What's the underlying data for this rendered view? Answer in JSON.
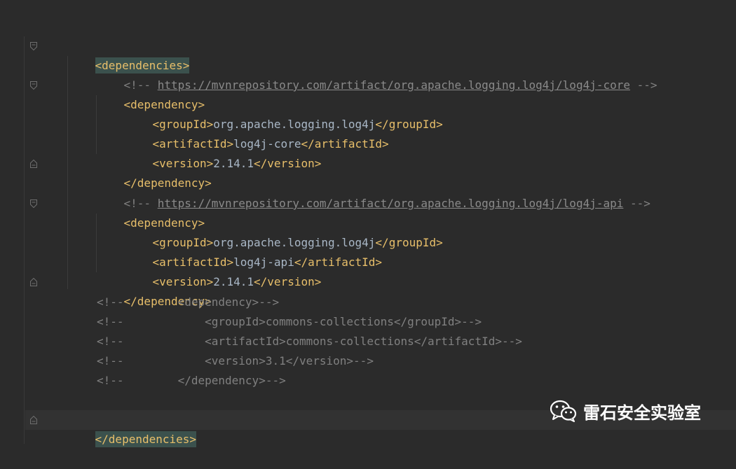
{
  "editor": {
    "lines": {
      "l1_open": "<dependencies>",
      "l2_comment_start": "<!-- ",
      "l2_url": "https://mvnrepository.com/artifact/org.apache.logging.log4j/log4j-core",
      "l2_comment_end": " -->",
      "l3": "<dependency>",
      "l4_open": "<groupId>",
      "l4_val": "org.apache.logging.log4j",
      "l4_close": "</groupId>",
      "l5_open": "<artifactId>",
      "l5_val": "log4j-core",
      "l5_close": "</artifactId>",
      "l6_open": "<version>",
      "l6_val": "2.14.1",
      "l6_close": "</version>",
      "l7": "</dependency>",
      "l8_comment_start": "<!-- ",
      "l8_url": "https://mvnrepository.com/artifact/org.apache.logging.log4j/log4j-api",
      "l8_comment_end": " -->",
      "l9": "<dependency>",
      "l10_open": "<groupId>",
      "l10_val": "org.apache.logging.log4j",
      "l10_close": "</groupId>",
      "l11_open": "<artifactId>",
      "l11_val": "log4j-api",
      "l11_close": "</artifactId>",
      "l12_open": "<version>",
      "l12_val": "2.14.1",
      "l12_close": "</version>",
      "l13": "</dependency>",
      "l14": "<!--        <dependency>-->",
      "l15": "<!--            <groupId>commons-collections</groupId>-->",
      "l16": "<!--            <artifactId>commons-collections</artifactId>-->",
      "l17": "<!--            <version>3.1</version>-->",
      "l18": "<!--        </dependency>-->",
      "l20_close": "</dependencies>"
    },
    "colors": {
      "background": "#2b2b2b",
      "tag": "#e8bf6a",
      "text": "#a9b7c6",
      "comment": "#808080",
      "match_highlight": "#3b514d"
    }
  },
  "watermark": {
    "icon": "wechat-icon",
    "text": "雷石安全实验室"
  }
}
